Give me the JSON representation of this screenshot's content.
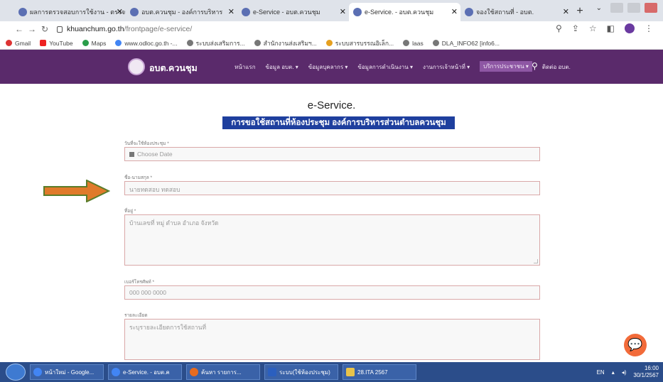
{
  "browser": {
    "tabs": [
      {
        "title": "ผลการตรวจสอบการใช้งาน - ตรวจสอบ"
      },
      {
        "title": "อบต.ควนชุม - องค์การบริหาร"
      },
      {
        "title": "e-Service - อบต.ควนชุม"
      },
      {
        "title": "e-Service. - อบต.ควนชุม"
      },
      {
        "title": "จองใช้สถานที่ - อบต."
      }
    ],
    "url_host": "khuanchum.go.th",
    "url_path": "/frontpage/e-service/",
    "bookmarks": [
      "Gmail",
      "YouTube",
      "Maps",
      "www.odloc.go.th -...",
      "ระบบส่งเสริมการ...",
      "สำนักงานส่งเสริมฯ...",
      "ระบบสารบรรณอิเล็ก...",
      "laas",
      "DLA_INFO62 [info6..."
    ]
  },
  "site": {
    "name": "อบต.ควนชุม",
    "menu": [
      "หน้าแรก",
      "ข้อมูล อบต. ▾",
      "ข้อมูลบุคลากร ▾",
      "ข้อมูลการดำเนินงาน ▾",
      "งานการเจ้าหน้าที่ ▾",
      "บริการประชาชน ▾",
      "ติดต่อ อบต."
    ]
  },
  "page": {
    "title": "e-Service.",
    "subtitle": "การขอใช้สถานที่ห้องประชุม องค์การบริหารส่วนตำบลควนชุม"
  },
  "form": {
    "date_label": "วันที่จะใช้ห้องประชุม *",
    "date_placeholder": "Choose Date",
    "name_label": "ชื่อ-นามสกุล *",
    "name_placeholder": "นายทดสอบ ทดสอบ",
    "address_label": "ที่อยู่ *",
    "address_placeholder": "บ้านเลขที่ หมู่ ตำบล อำเภอ จังหวัด",
    "phone_label": "เบอร์โทรศัพท์ *",
    "phone_placeholder": "000 000 0000",
    "purpose_label": "รายละเอียด",
    "purpose_placeholder": "ระบุรายละเอียดการใช้สถานที่"
  },
  "taskbar": {
    "items": [
      "หน้าใหม่ - Google...",
      "e-Service. - อบต.ค",
      "ค้นหา รายการ...",
      "ระบบ(ใช้ห้องประชุม)",
      "28.ITA 2567"
    ],
    "lang": "EN",
    "time": "16:00",
    "date": "30/1/2567"
  },
  "colors": {
    "header_purple": "#5a2a6b",
    "subtitle_blue": "#1e3f9e",
    "arrow_orange": "#e07a2a",
    "chat_orange": "#f26b3a"
  }
}
